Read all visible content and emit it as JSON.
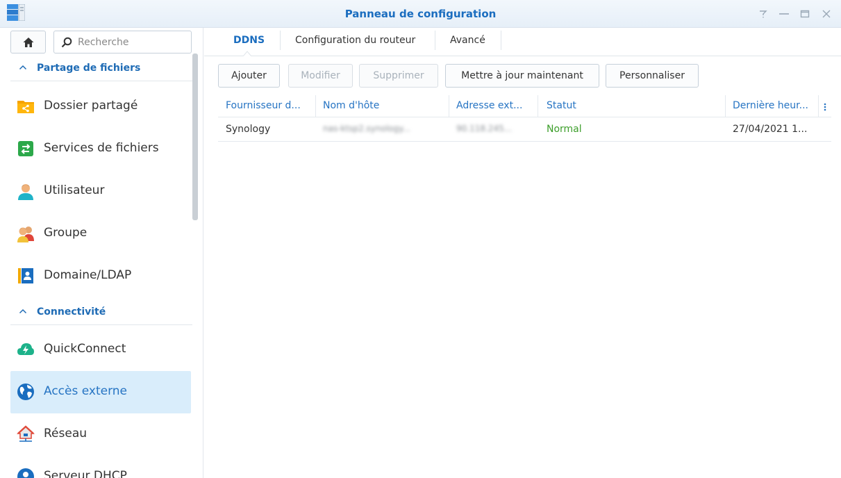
{
  "window": {
    "title": "Panneau de configuration",
    "controls": [
      "help-icon",
      "minimize-icon",
      "maximize-icon",
      "close-icon"
    ]
  },
  "sidebar": {
    "search": {
      "placeholder": "Recherche",
      "value": ""
    },
    "sections": [
      {
        "label": "Partage de fichiers",
        "items": [
          {
            "label": "Dossier partagé",
            "icon": "shared-folder-icon",
            "active": false
          },
          {
            "label": "Services de fichiers",
            "icon": "file-services-icon",
            "active": false
          },
          {
            "label": "Utilisateur",
            "icon": "user-icon",
            "active": false
          },
          {
            "label": "Groupe",
            "icon": "group-icon",
            "active": false
          },
          {
            "label": "Domaine/LDAP",
            "icon": "domain-ldap-icon",
            "active": false
          }
        ]
      },
      {
        "label": "Connectivité",
        "items": [
          {
            "label": "QuickConnect",
            "icon": "quickconnect-icon",
            "active": false
          },
          {
            "label": "Accès externe",
            "icon": "globe-icon",
            "active": true
          },
          {
            "label": "Réseau",
            "icon": "network-icon",
            "active": false
          },
          {
            "label": "Serveur DHCP",
            "icon": "dhcp-server-icon",
            "active": false
          }
        ]
      }
    ]
  },
  "tabs": [
    {
      "label": "DDNS",
      "active": true
    },
    {
      "label": "Configuration du routeur",
      "active": false
    },
    {
      "label": "Avancé",
      "active": false
    }
  ],
  "toolbar": {
    "add": "Ajouter",
    "edit": "Modifier",
    "delete": "Supprimer",
    "update_now": "Mettre à jour maintenant",
    "customize": "Personnaliser"
  },
  "grid": {
    "columns": [
      "Fournisseur d...",
      "Nom d'hôte",
      "Adresse ext...",
      "Statut",
      "Dernière heur..."
    ],
    "rows": [
      {
        "provider": "Synology",
        "hostname": "nas-ktsp2.synology...",
        "address": "90.118.245...",
        "status": "Normal",
        "last_update": "27/04/2021 1..."
      }
    ]
  },
  "colors": {
    "accent": "#1a6dbf",
    "active_item_bg": "#d9edfb",
    "status_ok": "#3c9e2a"
  }
}
